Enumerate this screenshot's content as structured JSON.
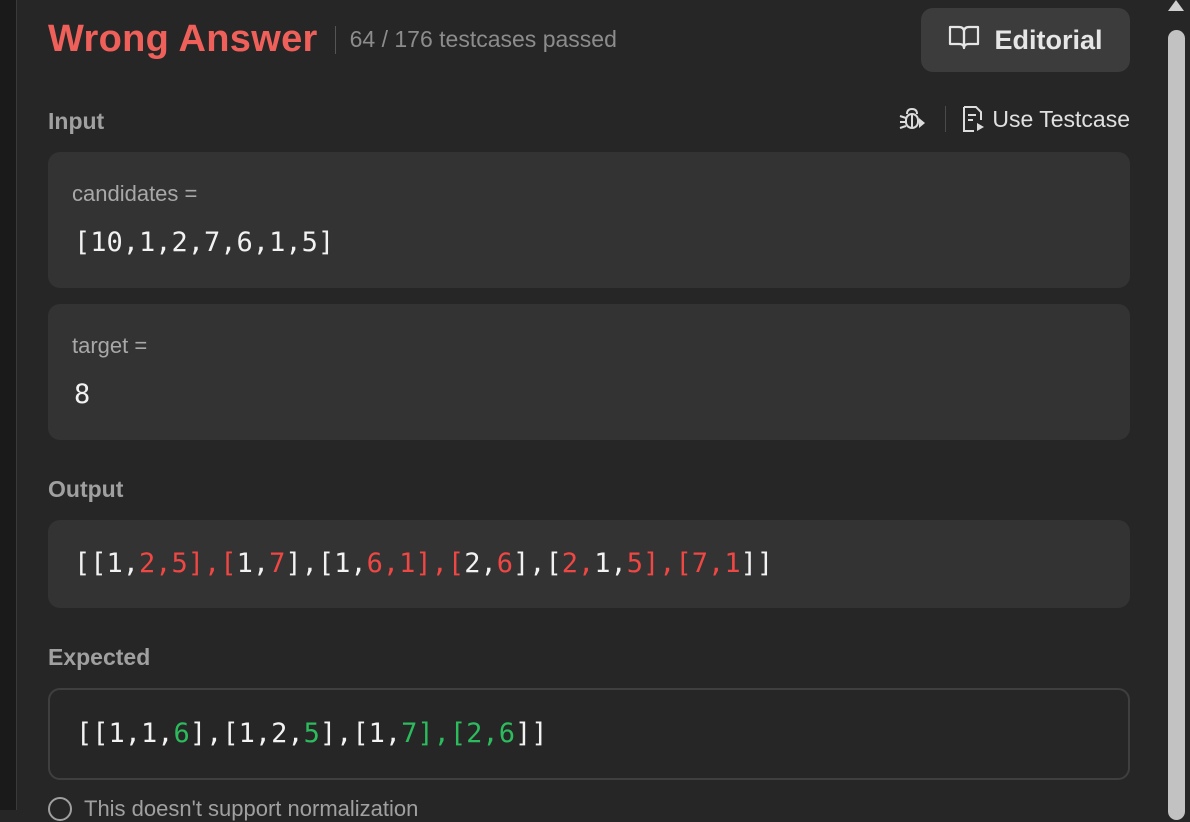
{
  "result": {
    "verdict": "Wrong Answer",
    "passed_text": "64 / 176 testcases passed",
    "editorial_label": "Editorial"
  },
  "input": {
    "label": "Input",
    "use_testcase_label": "Use Testcase",
    "params": [
      {
        "name": "candidates =",
        "value": "[10,1,2,7,6,1,5]"
      },
      {
        "name": "target =",
        "value": "8"
      }
    ]
  },
  "output": {
    "label": "Output",
    "tokens": [
      {
        "t": "[[1,",
        "c": "white"
      },
      {
        "t": "2,5],[",
        "c": "red"
      },
      {
        "t": "1,",
        "c": "white"
      },
      {
        "t": "7",
        "c": "red"
      },
      {
        "t": "],[1,",
        "c": "white"
      },
      {
        "t": "6,1],[",
        "c": "red"
      },
      {
        "t": "2,",
        "c": "white"
      },
      {
        "t": "6",
        "c": "red"
      },
      {
        "t": "],[",
        "c": "white"
      },
      {
        "t": "2,",
        "c": "red"
      },
      {
        "t": "1,",
        "c": "white"
      },
      {
        "t": "5],[7,1",
        "c": "red"
      },
      {
        "t": "]]",
        "c": "white"
      }
    ]
  },
  "expected": {
    "label": "Expected",
    "tokens": [
      {
        "t": "[[1,1,",
        "c": "white"
      },
      {
        "t": "6",
        "c": "green"
      },
      {
        "t": "],[1,2,",
        "c": "white"
      },
      {
        "t": "5",
        "c": "green"
      },
      {
        "t": "],[1,",
        "c": "white"
      },
      {
        "t": "7],[2,6",
        "c": "green"
      },
      {
        "t": "]]",
        "c": "white"
      }
    ]
  },
  "footnote": "This doesn't support normalization",
  "colors": {
    "verdict_red": "#f0605a",
    "diff_red": "#ef4743",
    "diff_green": "#2cbb5d",
    "panel_bg": "#262626",
    "card_bg": "#333333"
  }
}
